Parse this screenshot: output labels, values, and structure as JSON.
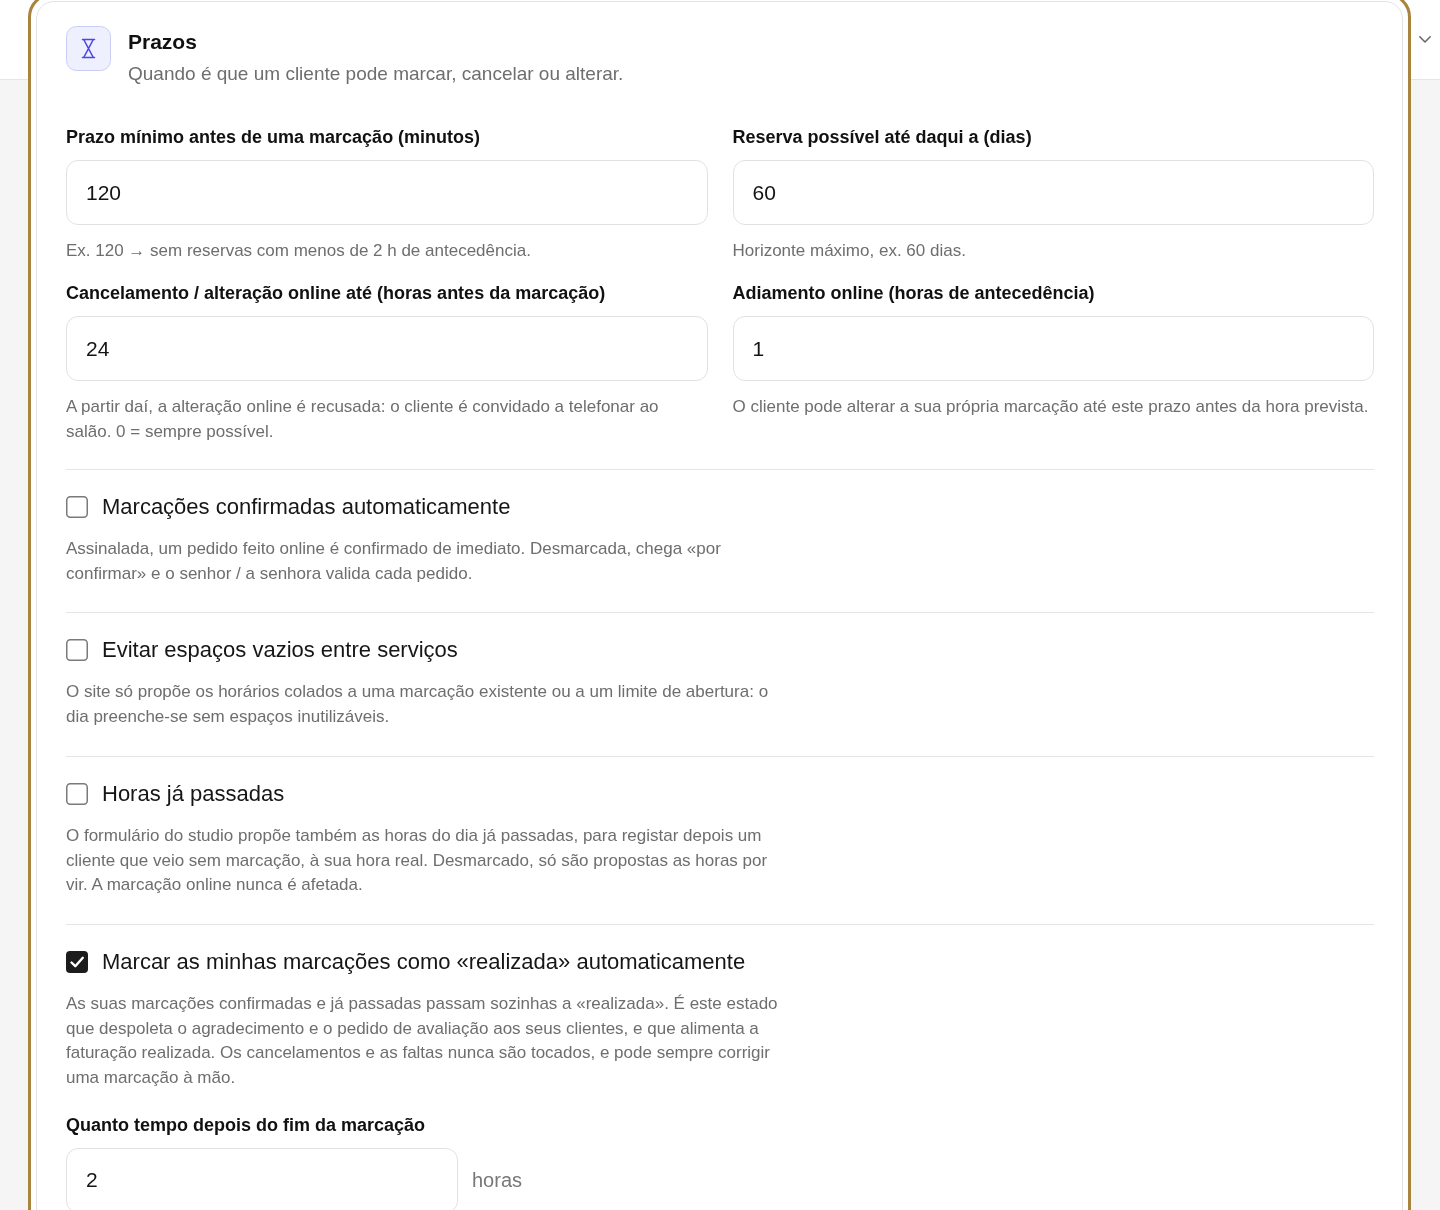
{
  "section": {
    "title": "Prazos",
    "subtitle": "Quando é que um cliente pode marcar, cancelar ou alterar."
  },
  "fields": [
    {
      "label": "Prazo mínimo antes de uma marcação (minutos)",
      "value": "120",
      "hint": "Ex. 120 → sem reservas com menos de 2 h de antecedência."
    },
    {
      "label": "Reserva possível até daqui a (dias)",
      "value": "60",
      "hint": "Horizonte máximo, ex. 60 dias."
    },
    {
      "label": "Cancelamento / alteração online até (horas antes da marcação)",
      "value": "24",
      "hint": "A partir daí, a alteração online é recusada: o cliente é convidado a telefonar ao salão. 0 = sempre possível."
    },
    {
      "label": "Adiamento online (horas de antecedência)",
      "value": "1",
      "hint": "O cliente pode alterar a sua própria marcação até este prazo antes da hora prevista."
    }
  ],
  "options": [
    {
      "label": "Marcações confirmadas automaticamente",
      "checked": false,
      "description": "Assinalada, um pedido feito online é confirmado de imediato. Desmarcada, chega «por confirmar» e o senhor / a senhora valida cada pedido."
    },
    {
      "label": "Evitar espaços vazios entre serviços",
      "checked": false,
      "description": "O site só propõe os horários colados a uma marcação existente ou a um limite de abertura: o dia preenche-se sem espaços inutilizáveis."
    },
    {
      "label": "Horas já passadas",
      "checked": false,
      "description": "O formulário do studio propõe também as horas do dia já passadas, para registar depois um cliente que veio sem marcação, à sua hora real. Desmarcado, só são propostas as horas por vir. A marcação online nunca é afetada."
    },
    {
      "label": "Marcar as minhas marcações como «realizada» automaticamente",
      "checked": true,
      "description": "As suas marcações confirmadas e já passadas passam sozinhas a «realizada». É este estado que despoleta o agradecimento e o pedido de avaliação aos seus clientes, e que alimenta a faturação realizada. Os cancelamentos e as faltas nunca são tocados, e pode sempre corrigir uma marcação à mão.",
      "detail": {
        "label": "Quanto tempo depois do fim da marcação",
        "value": "2",
        "unit": "horas"
      }
    }
  ]
}
